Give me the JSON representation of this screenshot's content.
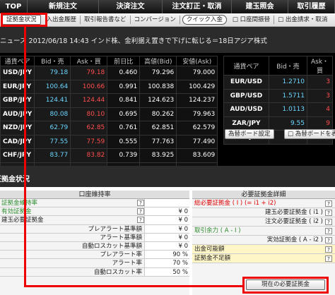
{
  "topnav": [
    "TOP",
    "新規注文",
    "決済注文",
    "注文訂正・取消",
    "建玉照会",
    "取引履歴"
  ],
  "subnav": {
    "active": "証拠金状況",
    "items": [
      "入出金履歴",
      "取引報告書など",
      "コンバージョン"
    ],
    "quick": "クイック入金",
    "tail": [
      "口座間振替",
      "出金請求・取消"
    ]
  },
  "news": "ニュース 2012/06/18 14:43 インド株、金利据え置きで下げに転じる＝18日アジア株式",
  "rates": {
    "headers": [
      "通貨ペア",
      "Bid・売",
      "Ask・買",
      "前日比",
      "高値(Bid)",
      "安値(Ask)"
    ],
    "rows": [
      {
        "pair": "USD/JPY",
        "bid": "79.18",
        "ask": "79.18",
        "prev": "0.460",
        "high": "79.296",
        "low": "79.000"
      },
      {
        "pair": "EUR/JPY",
        "bid": "100.64",
        "ask": "100.66",
        "prev": "0.991",
        "high": "100.838",
        "low": "100.429"
      },
      {
        "pair": "GBP/JPY",
        "bid": "124.41",
        "ask": "124.44",
        "prev": "0.841",
        "high": "124.623",
        "low": "124.237"
      },
      {
        "pair": "AUD/JPY",
        "bid": "80.08",
        "ask": "80.10",
        "prev": "0.695",
        "high": "80.262",
        "low": "79.963"
      },
      {
        "pair": "NZD/JPY",
        "bid": "62.79",
        "ask": "62.85",
        "prev": "0.761",
        "high": "62.851",
        "low": "62.579"
      },
      {
        "pair": "CAD/JPY",
        "bid": "77.55",
        "ask": "77.59",
        "prev": "0.555",
        "high": "77.763",
        "low": "77.490"
      },
      {
        "pair": "CHF/JPY",
        "bid": "83.77",
        "ask": "83.82",
        "prev": "0.739",
        "high": "83.925",
        "low": "83.609"
      },
      {
        "pair": "ZAR/JPY",
        "bid": "62.43",
        "ask": "62.49",
        "prev": "0.481",
        "high": "62.549",
        "low": "62.372"
      }
    ],
    "headers2": [
      "通貨ペア",
      "Bid・売",
      "Ask・買"
    ],
    "rows2": [
      {
        "pair": "EUR/USD",
        "bid": "1.2710",
        "ask": "3"
      },
      {
        "pair": "GBP/USD",
        "bid": "1.5711",
        "ask": "3"
      },
      {
        "pair": "AUD/USD",
        "bid": "1.0113",
        "ask": "4"
      },
      {
        "pair": "ZAR/JPY",
        "bid": "9.55",
        "ask": "9"
      },
      {
        "pair": "HKD/JPY",
        "bid": "10.20",
        "ask": "4"
      }
    ],
    "btn_setting": "為替ボード設定",
    "btn_show": "為替ボードを表示"
  },
  "margin": {
    "title": "証拠金状況",
    "left_header": "口座維持率",
    "left_rows": [
      {
        "label": "証拠金維持率",
        "value": "",
        "green": true
      },
      {
        "label": "有効証拠金",
        "value": "¥ 0",
        "green": true
      },
      {
        "label": "建玉必要証拠金",
        "value": "¥ 0",
        "green": false
      },
      {
        "label": "プレアラート基準額",
        "value": "¥ 0"
      },
      {
        "label": "アラート基準額",
        "value": "¥ 0"
      },
      {
        "label": "自動ロスカット基準額",
        "value": "¥ 0"
      },
      {
        "label": "プレアラート率",
        "value": "90 %"
      },
      {
        "label": "アラート率",
        "value": "70 %"
      },
      {
        "label": "自動ロスカット率",
        "value": "50 %"
      }
    ],
    "right_header": "必要証拠金詳細",
    "right_rows": [
      {
        "label": "総必要証拠金 ( I ) (= i1 + i2)",
        "color": "red",
        "align": "left"
      },
      {
        "label": "建玉必要証拠金 ( i1 )",
        "color": "",
        "align": "right"
      },
      {
        "label": "注文必要証拠金 ( i2 )",
        "color": "",
        "align": "right"
      },
      {
        "label": "取引余力 ( A - I )",
        "color": "green",
        "align": "left"
      },
      {
        "label": "実効証拠金 ( A - i2 )",
        "color": "",
        "align": "right"
      },
      {
        "label": "出金可能額",
        "color": "",
        "align": "left"
      },
      {
        "label": "証拠金不足額",
        "color": "",
        "align": "left"
      }
    ],
    "current_btn": "現在の必要証拠金"
  }
}
